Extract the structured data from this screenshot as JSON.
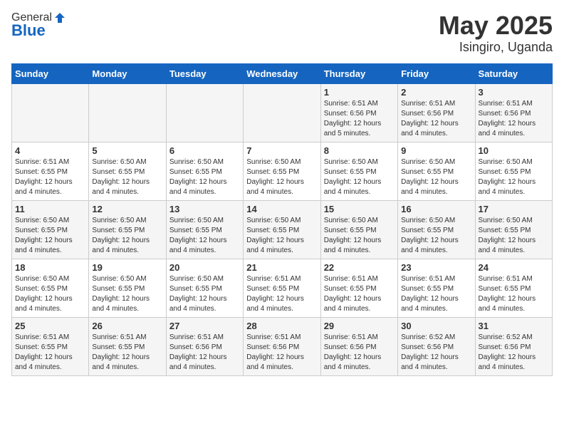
{
  "logo": {
    "general": "General",
    "blue": "Blue"
  },
  "header": {
    "month": "May 2025",
    "location": "Isingiro, Uganda"
  },
  "weekdays": [
    "Sunday",
    "Monday",
    "Tuesday",
    "Wednesday",
    "Thursday",
    "Friday",
    "Saturday"
  ],
  "weeks": [
    [
      {
        "day": "",
        "info": ""
      },
      {
        "day": "",
        "info": ""
      },
      {
        "day": "",
        "info": ""
      },
      {
        "day": "",
        "info": ""
      },
      {
        "day": "1",
        "info": "Sunrise: 6:51 AM\nSunset: 6:56 PM\nDaylight: 12 hours\nand 5 minutes."
      },
      {
        "day": "2",
        "info": "Sunrise: 6:51 AM\nSunset: 6:56 PM\nDaylight: 12 hours\nand 4 minutes."
      },
      {
        "day": "3",
        "info": "Sunrise: 6:51 AM\nSunset: 6:56 PM\nDaylight: 12 hours\nand 4 minutes."
      }
    ],
    [
      {
        "day": "4",
        "info": "Sunrise: 6:51 AM\nSunset: 6:55 PM\nDaylight: 12 hours\nand 4 minutes."
      },
      {
        "day": "5",
        "info": "Sunrise: 6:50 AM\nSunset: 6:55 PM\nDaylight: 12 hours\nand 4 minutes."
      },
      {
        "day": "6",
        "info": "Sunrise: 6:50 AM\nSunset: 6:55 PM\nDaylight: 12 hours\nand 4 minutes."
      },
      {
        "day": "7",
        "info": "Sunrise: 6:50 AM\nSunset: 6:55 PM\nDaylight: 12 hours\nand 4 minutes."
      },
      {
        "day": "8",
        "info": "Sunrise: 6:50 AM\nSunset: 6:55 PM\nDaylight: 12 hours\nand 4 minutes."
      },
      {
        "day": "9",
        "info": "Sunrise: 6:50 AM\nSunset: 6:55 PM\nDaylight: 12 hours\nand 4 minutes."
      },
      {
        "day": "10",
        "info": "Sunrise: 6:50 AM\nSunset: 6:55 PM\nDaylight: 12 hours\nand 4 minutes."
      }
    ],
    [
      {
        "day": "11",
        "info": "Sunrise: 6:50 AM\nSunset: 6:55 PM\nDaylight: 12 hours\nand 4 minutes."
      },
      {
        "day": "12",
        "info": "Sunrise: 6:50 AM\nSunset: 6:55 PM\nDaylight: 12 hours\nand 4 minutes."
      },
      {
        "day": "13",
        "info": "Sunrise: 6:50 AM\nSunset: 6:55 PM\nDaylight: 12 hours\nand 4 minutes."
      },
      {
        "day": "14",
        "info": "Sunrise: 6:50 AM\nSunset: 6:55 PM\nDaylight: 12 hours\nand 4 minutes."
      },
      {
        "day": "15",
        "info": "Sunrise: 6:50 AM\nSunset: 6:55 PM\nDaylight: 12 hours\nand 4 minutes."
      },
      {
        "day": "16",
        "info": "Sunrise: 6:50 AM\nSunset: 6:55 PM\nDaylight: 12 hours\nand 4 minutes."
      },
      {
        "day": "17",
        "info": "Sunrise: 6:50 AM\nSunset: 6:55 PM\nDaylight: 12 hours\nand 4 minutes."
      }
    ],
    [
      {
        "day": "18",
        "info": "Sunrise: 6:50 AM\nSunset: 6:55 PM\nDaylight: 12 hours\nand 4 minutes."
      },
      {
        "day": "19",
        "info": "Sunrise: 6:50 AM\nSunset: 6:55 PM\nDaylight: 12 hours\nand 4 minutes."
      },
      {
        "day": "20",
        "info": "Sunrise: 6:50 AM\nSunset: 6:55 PM\nDaylight: 12 hours\nand 4 minutes."
      },
      {
        "day": "21",
        "info": "Sunrise: 6:51 AM\nSunset: 6:55 PM\nDaylight: 12 hours\nand 4 minutes."
      },
      {
        "day": "22",
        "info": "Sunrise: 6:51 AM\nSunset: 6:55 PM\nDaylight: 12 hours\nand 4 minutes."
      },
      {
        "day": "23",
        "info": "Sunrise: 6:51 AM\nSunset: 6:55 PM\nDaylight: 12 hours\nand 4 minutes."
      },
      {
        "day": "24",
        "info": "Sunrise: 6:51 AM\nSunset: 6:55 PM\nDaylight: 12 hours\nand 4 minutes."
      }
    ],
    [
      {
        "day": "25",
        "info": "Sunrise: 6:51 AM\nSunset: 6:55 PM\nDaylight: 12 hours\nand 4 minutes."
      },
      {
        "day": "26",
        "info": "Sunrise: 6:51 AM\nSunset: 6:55 PM\nDaylight: 12 hours\nand 4 minutes."
      },
      {
        "day": "27",
        "info": "Sunrise: 6:51 AM\nSunset: 6:56 PM\nDaylight: 12 hours\nand 4 minutes."
      },
      {
        "day": "28",
        "info": "Sunrise: 6:51 AM\nSunset: 6:56 PM\nDaylight: 12 hours\nand 4 minutes."
      },
      {
        "day": "29",
        "info": "Sunrise: 6:51 AM\nSunset: 6:56 PM\nDaylight: 12 hours\nand 4 minutes."
      },
      {
        "day": "30",
        "info": "Sunrise: 6:52 AM\nSunset: 6:56 PM\nDaylight: 12 hours\nand 4 minutes."
      },
      {
        "day": "31",
        "info": "Sunrise: 6:52 AM\nSunset: 6:56 PM\nDaylight: 12 hours\nand 4 minutes."
      }
    ]
  ]
}
